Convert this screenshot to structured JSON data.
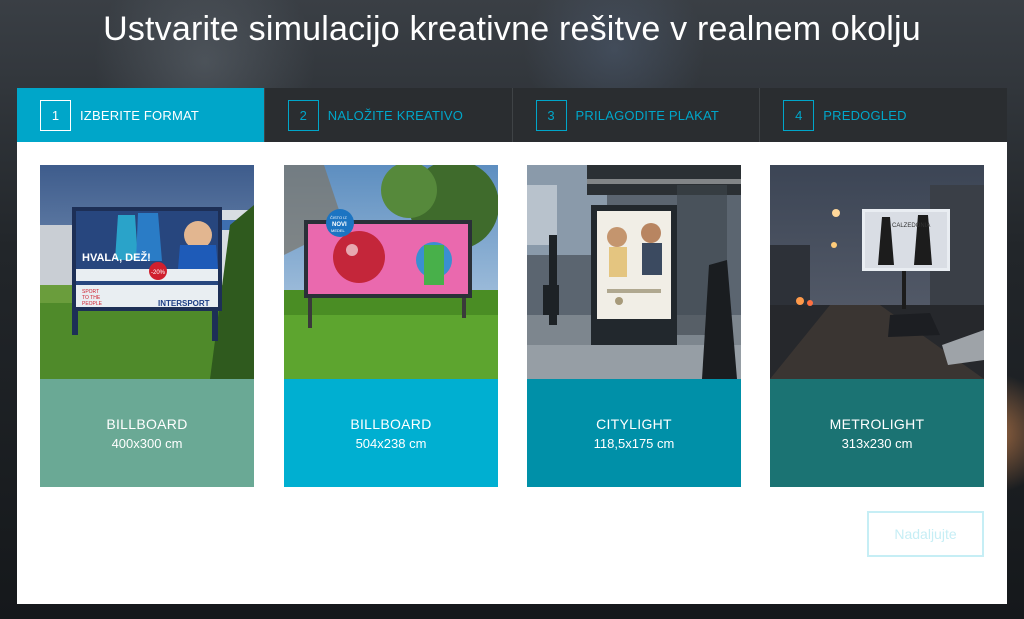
{
  "page": {
    "title": "Ustvarite simulacijo kreativne rešitve v realnem okolju"
  },
  "steps": [
    {
      "number": "1",
      "label": "IZBERITE FORMAT",
      "active": true
    },
    {
      "number": "2",
      "label": "NALOŽITE KREATIVO",
      "active": false
    },
    {
      "number": "3",
      "label": "PRILAGODITE PLAKAT",
      "active": false
    },
    {
      "number": "4",
      "label": "PREDOGLED",
      "active": false
    }
  ],
  "formats": [
    {
      "name": "BILLBOARD",
      "size": "400x300 cm",
      "color": "#6aa995",
      "photo": {
        "ad_headline": "HVALA, DEŽ!",
        "ad_brand": "INTERSPORT",
        "ad_tagline1": "SPORT",
        "ad_tagline2": "TO THE",
        "ad_tagline3": "PEOPLE",
        "ad_badge": "-20%"
      }
    },
    {
      "name": "BILLBOARD",
      "size": "504x238 cm",
      "color": "#00afd1",
      "photo": {
        "ad_badge_line1": "ČISTO IZ",
        "ad_badge_line2": "NOVI",
        "ad_badge_line3": "MEDEL"
      }
    },
    {
      "name": "CITYLIGHT",
      "size": "118,5x175 cm",
      "color": "#0090a8",
      "photo": {}
    },
    {
      "name": "METROLIGHT",
      "size": "313x230 cm",
      "color": "#1b7373",
      "photo": {
        "ad_brand": "CALZEDONIA"
      }
    }
  ],
  "actions": {
    "next_label": "Nadaljujte"
  }
}
